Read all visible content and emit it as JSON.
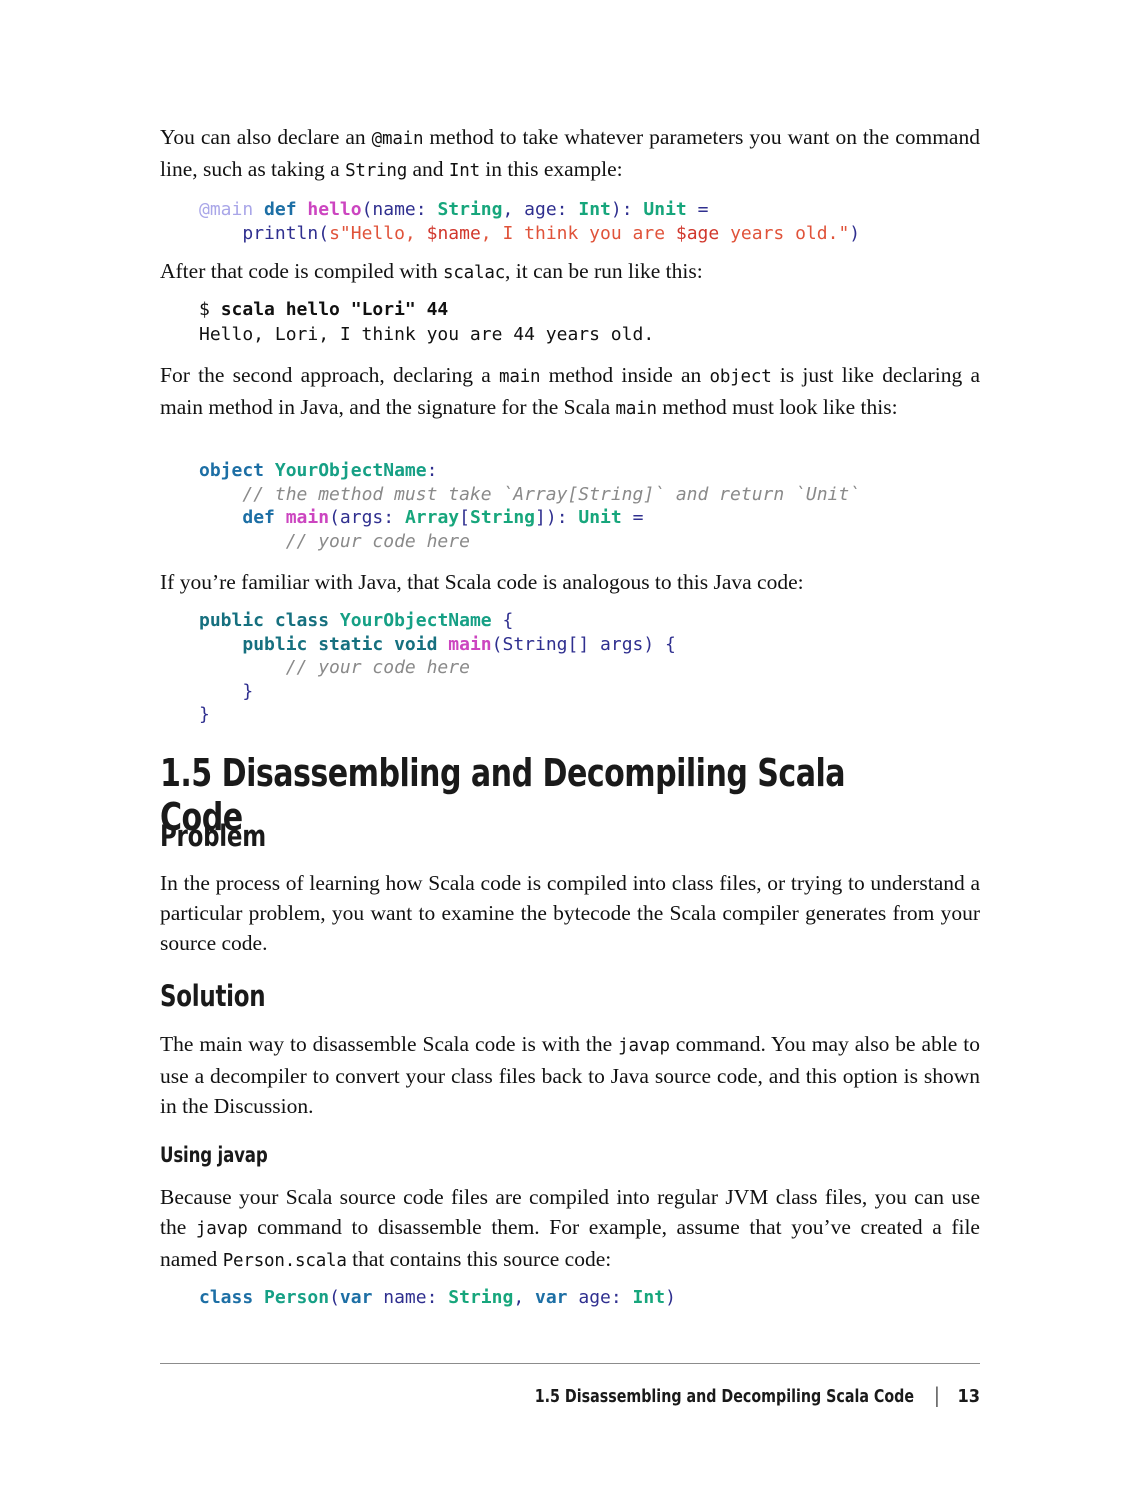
{
  "page": {
    "number": "13",
    "running_head": "1.5 Disassembling and Decompiling Scala Code",
    "separator": "|"
  },
  "blocks": {
    "intro_para": "You can also declare an @main method to take whatever parameters you want on the command line, such as taking a String and Int in this example:",
    "intro_para_parts": {
      "t1": "You can also declare an ",
      "c1": "@main",
      "t2": " method to take whatever parameters you want on the command line, such as taking a ",
      "c2": "String",
      "t3": " and ",
      "c3": "Int",
      "t4": " in this example:"
    },
    "after_compiled_parts": {
      "t1": "After that code is compiled with ",
      "c1": "scalac",
      "t2": ", it can be run like this:"
    },
    "second_approach_parts": {
      "t1": "For the second approach, declaring a ",
      "c1": "main",
      "t2": " method inside an ",
      "c2": "object",
      "t3": " is just like declaring a main method in Java, and the signature for the Scala ",
      "c3": "main",
      "t4": " method must look like this:"
    },
    "familiar_java": "If you’re familiar with Java, that Scala code is analogous to this Java code:",
    "section_title": "1.5 Disassembling and Decompiling Scala Code",
    "problem_heading": "Problem",
    "problem_para": "In the process of learning how Scala code is compiled into class files, or trying to understand a particular problem, you want to examine the bytecode the Scala com­piler generates from your source code.",
    "solution_heading": "Solution",
    "solution_para_parts": {
      "t1": "The main way to disassemble Scala code is with the ",
      "c1": "javap",
      "t2": " command. You may also be able to use a decompiler to convert your class files back to Java source code, and this option is shown in the Discussion."
    },
    "using_javap_heading": "Using javap",
    "using_javap_para_parts": {
      "t1": "Because your Scala source code files are compiled into regular JVM class files, you can use the ",
      "c1": "javap",
      "t2": " command to disassemble them. For example, assume that you’ve created a file named ",
      "c2": "Person.scala",
      "t3": " that contains this source code:"
    }
  },
  "code_blocks": {
    "main_method": {
      "lines": [
        "@main def hello(name: String, age: Int): Unit =",
        "    println(s\"Hello, $name, I think you are $age years old.\")"
      ],
      "tokens": {
        "l1": {
          "ann": "@main",
          "kw_def": "def",
          "fn": "hello",
          "p_open": "(",
          "arg1": "name: ",
          "t_string": "String",
          "comma": ", ",
          "arg2": "age: ",
          "t_int": "Int",
          "p_close": "): ",
          "t_unit": "Unit",
          "eq": " ="
        },
        "l2": {
          "indent": "    ",
          "println": "println",
          "p_open": "(",
          "s_prefix": "s",
          "str1": "\"Hello, ",
          "v1": "$name",
          "str2": ", I think you are ",
          "v2": "$age",
          "str3": " years old.\"",
          "p_close": ")"
        }
      }
    },
    "terminal": {
      "prompt": "$ ",
      "command": "scala hello \"Lori\" 44",
      "output": "Hello, Lori, I think you are 44 years old."
    },
    "object_main": {
      "lines": [
        "object YourObjectName:",
        "    // the method must take `Array[String]` and return `Unit`",
        "    def main(args: Array[String]): Unit =",
        "        // your code here"
      ],
      "tokens": {
        "l1": {
          "kw": "object",
          "name": "YourObjectName",
          "colon": ":"
        },
        "l2": {
          "indent": "    ",
          "comment": "// the method must take `Array[String]` and return `Unit`"
        },
        "l3": {
          "indent": "    ",
          "kw_def": "def",
          "fn": "main",
          "p_open": "(",
          "arg": "args: ",
          "t_array": "Array",
          "br_open": "[",
          "t_string": "String",
          "br_close": "]",
          "p_close": "): ",
          "t_unit": "Unit",
          "eq": " ="
        },
        "l4": {
          "indent": "        ",
          "comment": "// your code here"
        }
      }
    },
    "java_class": {
      "lines": [
        "public class YourObjectName {",
        "    public static void main(String[] args) {",
        "        // your code here",
        "    }",
        "}"
      ],
      "tokens": {
        "l1": {
          "kw_public": "public",
          "kw_class": " class",
          "name": "YourObjectName",
          "brace": " {"
        },
        "l2": {
          "indent": "    ",
          "kw": "public static void",
          "fn": "main",
          "p_open": "(",
          "t_string": "String[] args",
          "p_close": ")",
          "brace": " {"
        },
        "l3": {
          "indent": "        ",
          "comment": "// your code here"
        },
        "l4": {
          "indent": "    ",
          "brace": "}"
        },
        "l5": {
          "brace": "}"
        }
      }
    },
    "person_class": {
      "lines": [
        "class Person(var name: String, var age: Int)"
      ],
      "tokens": {
        "l1": {
          "kw_class": "class",
          "name": "Person",
          "p_open": "(",
          "kw_var1": "var",
          "arg1": " name: ",
          "t_string": "String",
          "comma": ", ",
          "kw_var2": "var",
          "arg2": " age: ",
          "t_int": "Int",
          "p_close": ")"
        }
      }
    }
  },
  "colors": {
    "keyword": "#1d6fa5",
    "java_keyword": "#16707f",
    "type": "#17a67c",
    "class_name": "#16a085",
    "function": "#cc45c0",
    "annotation": "#a9a6e8",
    "string": "#e0533a",
    "interp_var": "#d1372c",
    "comment": "#8a8a8a",
    "plain": "#2f2f8f",
    "text": "#111111",
    "rule": "#8c8c8c"
  }
}
